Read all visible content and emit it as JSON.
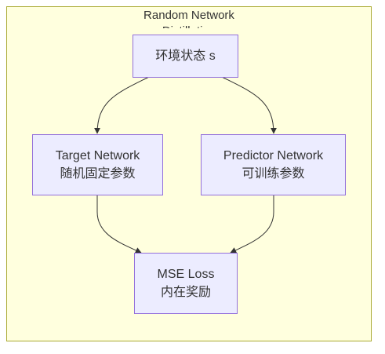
{
  "diagram": {
    "cluster_title": "Random Network Distillation",
    "nodes": {
      "state": {
        "label": "环境状态 s"
      },
      "target": {
        "line1": "Target Network",
        "line2": "随机固定参数"
      },
      "predictor": {
        "line1": "Predictor Network",
        "line2": "可训练参数"
      },
      "mse": {
        "line1": "MSE Loss",
        "line2": "内在奖励"
      }
    },
    "edges": [
      {
        "from": "state",
        "to": "target"
      },
      {
        "from": "state",
        "to": "predictor"
      },
      {
        "from": "target",
        "to": "mse"
      },
      {
        "from": "predictor",
        "to": "mse"
      }
    ]
  },
  "colors": {
    "cluster_fill": "#ffffde",
    "cluster_stroke": "#aaaa33",
    "node_fill": "#ececff",
    "node_stroke": "#9370db",
    "edge": "#333333",
    "text": "#333333"
  }
}
